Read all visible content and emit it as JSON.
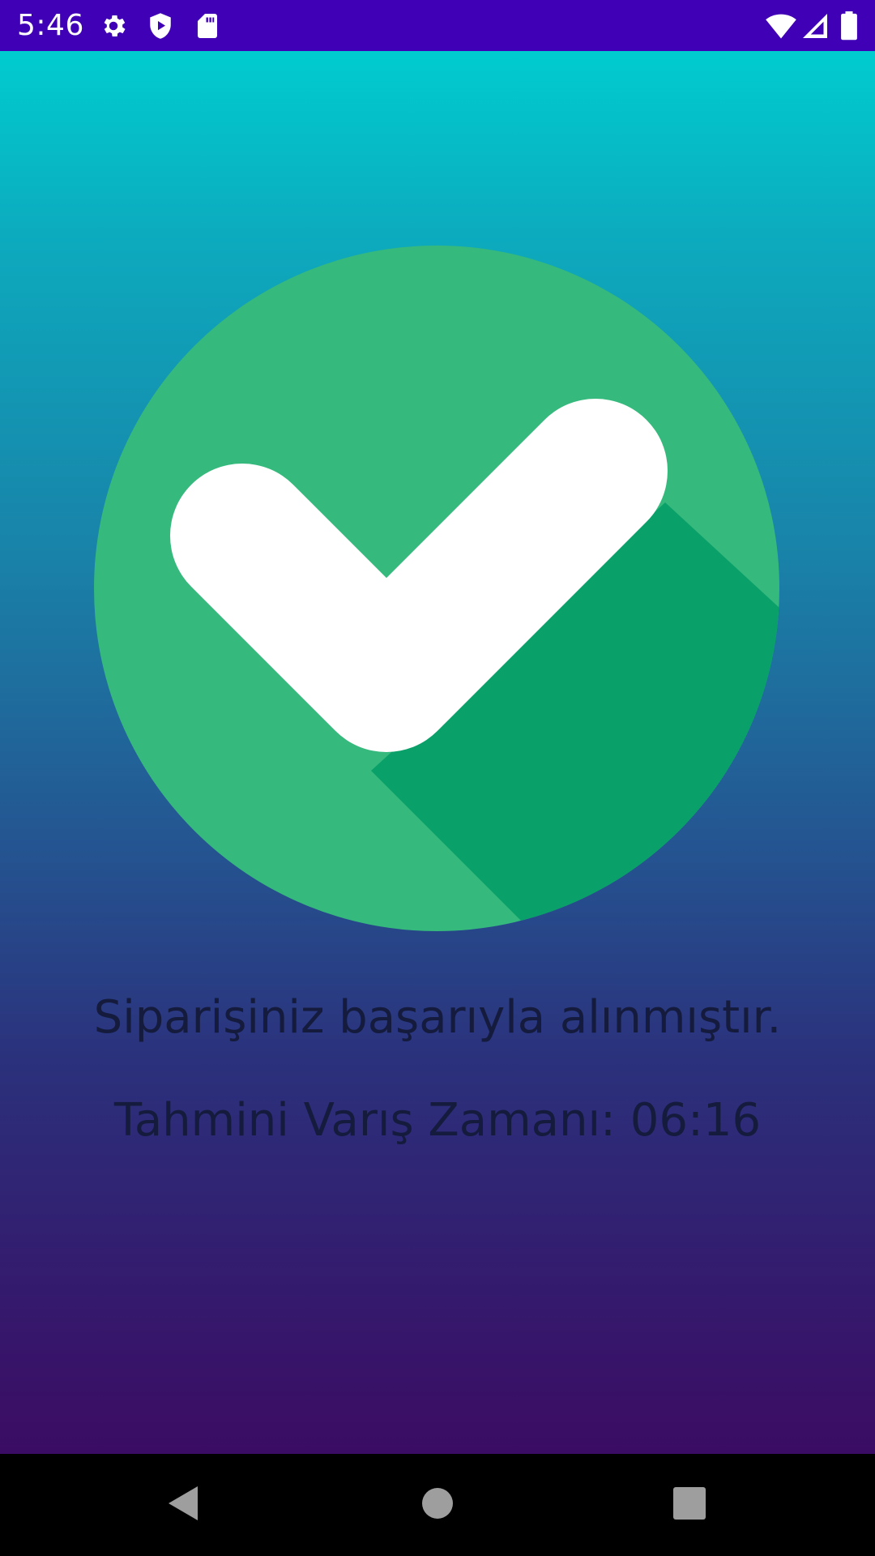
{
  "status_bar": {
    "time": "5:46",
    "background": "#3f00b6",
    "icons_left": [
      "settings-icon",
      "play-protect-icon",
      "sd-card-icon"
    ],
    "icons_right": [
      "wifi-icon",
      "signal-icon",
      "battery-icon"
    ]
  },
  "screen": {
    "success_icon": "check-circle-icon",
    "success_message": "Siparişiniz başarıyla alınmıştır.",
    "eta_text": "Tahmini Varış Zamanı: 06:16",
    "colors": {
      "gradient_top": "#00cccf",
      "gradient_bottom": "#3b0c63",
      "circle": "#36b97c",
      "circle_shadow": "#0aa06a",
      "text": "#141b3d"
    }
  },
  "nav_bar": {
    "buttons": [
      "back-icon",
      "home-icon",
      "recents-icon"
    ]
  }
}
